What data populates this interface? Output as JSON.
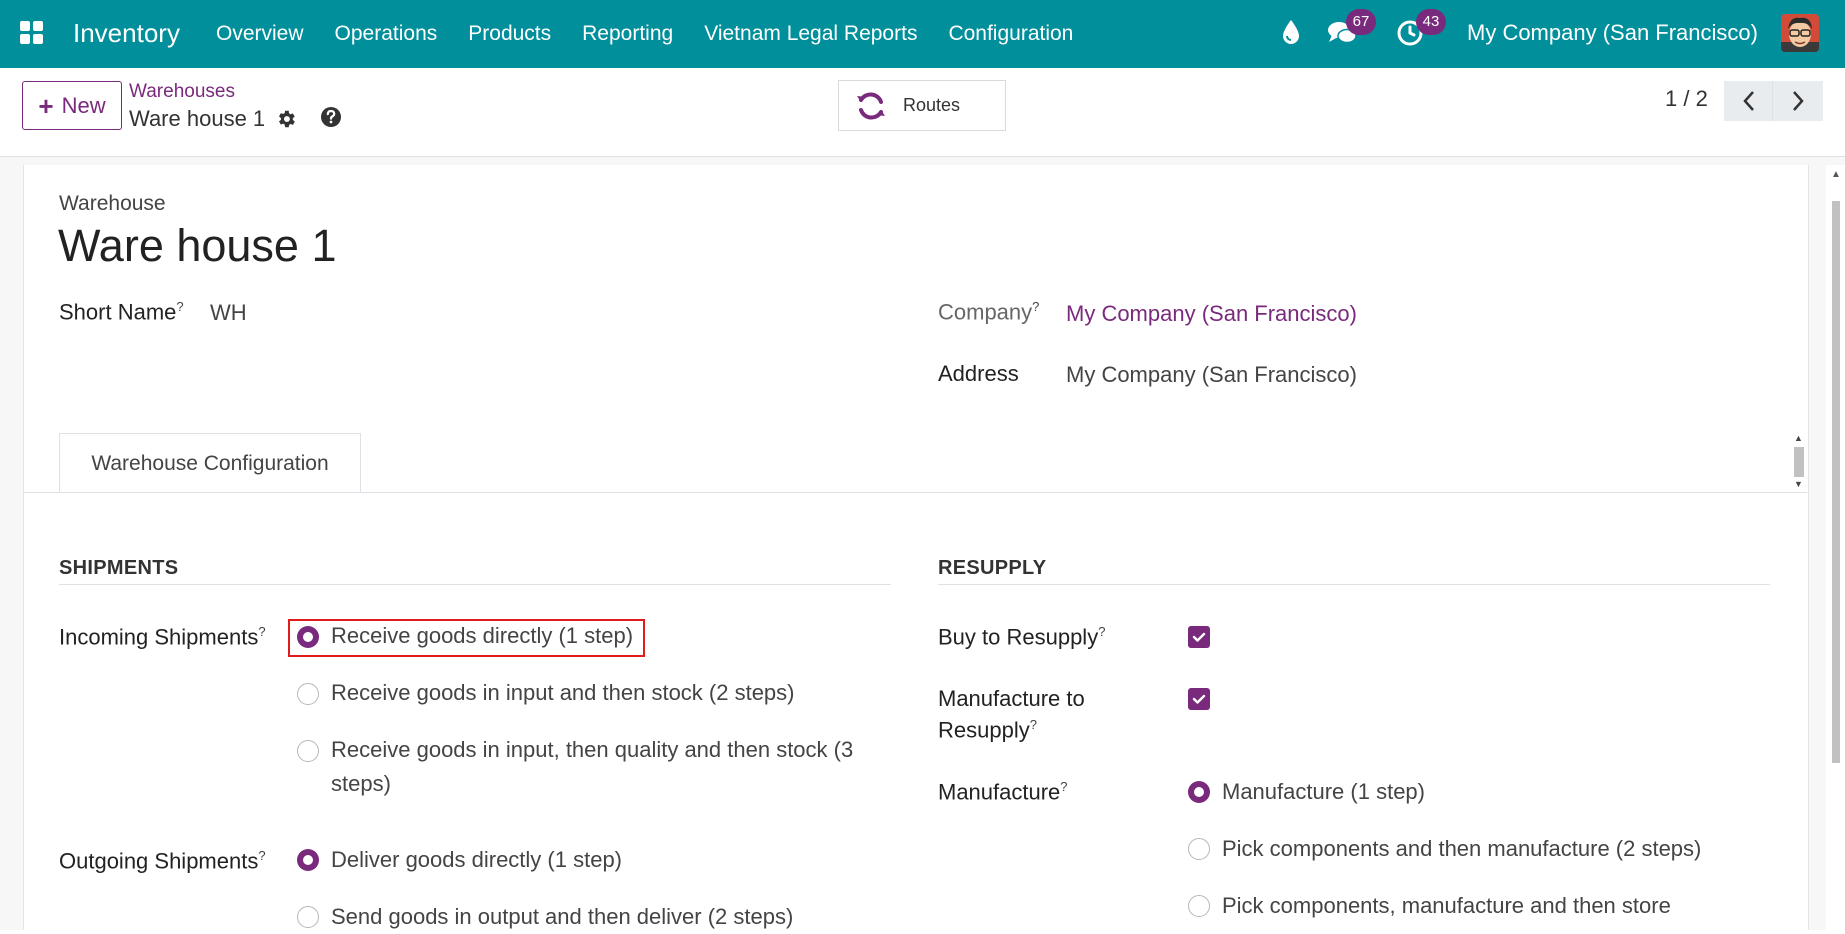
{
  "navbar": {
    "app_name": "Inventory",
    "menu": [
      "Overview",
      "Operations",
      "Products",
      "Reporting",
      "Vietnam Legal Reports",
      "Configuration"
    ],
    "messages_count": "67",
    "activities_count": "43",
    "company": "My Company (San Francisco)",
    "icons": [
      "apps-grid-icon",
      "drop-icon",
      "chat-icon",
      "clock-icon",
      "avatar"
    ]
  },
  "control": {
    "new_label": "New",
    "breadcrumb_parent": "Warehouses",
    "breadcrumb_current": "Ware house 1",
    "routes_label": "Routes",
    "pager": "1 / 2"
  },
  "form": {
    "record_type": "Warehouse",
    "name": "Ware house 1",
    "short_name_label": "Short Name",
    "short_name_value": "WH",
    "company_label": "Company",
    "company_value": "My Company (San Francisco)",
    "address_label": "Address",
    "address_value": "My Company (San Francisco)",
    "help_marker": "?"
  },
  "tabs": [
    "Warehouse Configuration"
  ],
  "shipments": {
    "title": "SHIPMENTS",
    "incoming_label": "Incoming Shipments",
    "incoming_options": [
      "Receive goods directly (1 step)",
      "Receive goods in input and then stock (2 steps)",
      "Receive goods in input, then quality and then stock (3 steps)"
    ],
    "incoming_selected": 0,
    "outgoing_label": "Outgoing Shipments",
    "outgoing_options": [
      "Deliver goods directly (1 step)",
      "Send goods in output and then deliver (2 steps)"
    ],
    "outgoing_selected": 0
  },
  "resupply": {
    "title": "RESUPPLY",
    "buy_label": "Buy to Resupply",
    "buy_checked": true,
    "manufacture_resupply_label_1": "Manufacture to",
    "manufacture_resupply_label_2": "Resupply",
    "manufacture_resupply_checked": true,
    "manufacture_label": "Manufacture",
    "manufacture_options": [
      "Manufacture (1 step)",
      "Pick components and then manufacture (2 steps)",
      "Pick components, manufacture and then store"
    ],
    "manufacture_selected": 0
  },
  "colors": {
    "navbar": "#008f9b",
    "accent": "#7a2a7c",
    "highlight": "#e01b1b"
  }
}
